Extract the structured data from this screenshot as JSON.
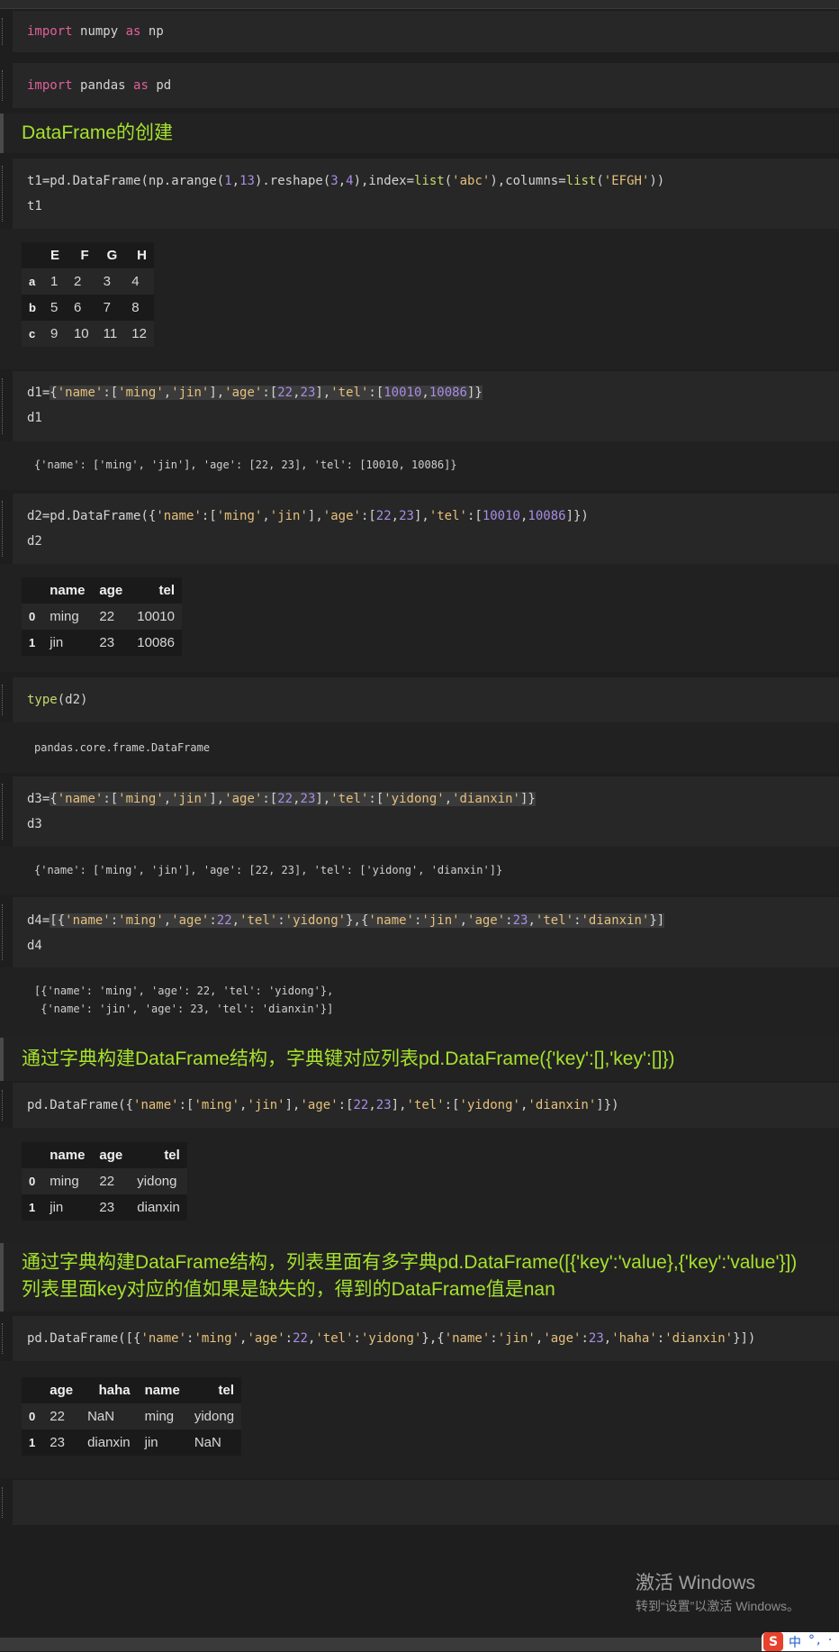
{
  "cells": {
    "c1": [
      "import numpy as np"
    ],
    "c2": [
      "import pandas as pd"
    ],
    "h1": "DataFrame的创建",
    "c3": [
      "t1=pd.DataFrame(np.arange(1,13).reshape(3,4),index=list('abc'),columns=list('EFGH'))",
      "t1"
    ],
    "t1": {
      "columns": [
        "",
        "E",
        "F",
        "G",
        "H"
      ],
      "rows": [
        [
          "a",
          "1",
          "2",
          "3",
          "4"
        ],
        [
          "b",
          "5",
          "6",
          "7",
          "8"
        ],
        [
          "c",
          "9",
          "10",
          "11",
          "12"
        ]
      ]
    },
    "c4": [
      "d1={'name':['ming','jin'],'age':[22,23],'tel':[10010,10086]}",
      "d1"
    ],
    "o4": [
      "{'name': ['ming', 'jin'], 'age': [22, 23], 'tel': [10010, 10086]}"
    ],
    "c5": [
      "d2=pd.DataFrame({'name':['ming','jin'],'age':[22,23],'tel':[10010,10086]})",
      "d2"
    ],
    "t2": {
      "columns": [
        "",
        "name",
        "age",
        "tel"
      ],
      "rows": [
        [
          "0",
          "ming",
          "22",
          "10010"
        ],
        [
          "1",
          "jin",
          "23",
          "10086"
        ]
      ]
    },
    "c6": [
      "type(d2)"
    ],
    "o6": [
      "pandas.core.frame.DataFrame"
    ],
    "c7": [
      "d3={'name':['ming','jin'],'age':[22,23],'tel':['yidong','dianxin']}",
      "d3"
    ],
    "o7": [
      "{'name': ['ming', 'jin'], 'age': [22, 23], 'tel': ['yidong', 'dianxin']}"
    ],
    "c8": [
      "d4=[{'name':'ming','age':22,'tel':'yidong'},{'name':'jin','age':23,'tel':'dianxin'}]",
      "d4"
    ],
    "o8": [
      "[{'name': 'ming', 'age': 22, 'tel': 'yidong'},",
      " {'name': 'jin', 'age': 23, 'tel': 'dianxin'}]"
    ],
    "h2": "通过字典构建DataFrame结构，字典键对应列表pd.DataFrame({'key':[],'key':[]})",
    "c9": [
      "pd.DataFrame({'name':['ming','jin'],'age':[22,23],'tel':['yidong','dianxin']})"
    ],
    "t3": {
      "columns": [
        "",
        "name",
        "age",
        "tel"
      ],
      "rows": [
        [
          "0",
          "ming",
          "22",
          "yidong"
        ],
        [
          "1",
          "jin",
          "23",
          "dianxin"
        ]
      ]
    },
    "h3": [
      "通过字典构建DataFrame结构，列表里面有多字典pd.DataFrame([{'key':'value},{'key':'value'}])",
      "列表里面key对应的值如果是缺失的，得到的DataFrame值是nan"
    ],
    "c10": [
      "pd.DataFrame([{'name':'ming','age':22,'tel':'yidong'},{'name':'jin','age':23,'haha':'dianxin'}])"
    ],
    "t4": {
      "columns": [
        "",
        "age",
        "haha",
        "name",
        "tel"
      ],
      "rows": [
        [
          "0",
          "22",
          "NaN",
          "ming",
          "yidong"
        ],
        [
          "1",
          "23",
          "dianxin",
          "jin",
          "NaN"
        ]
      ]
    }
  },
  "watermark": {
    "title": "激活 Windows",
    "subtitle": "转到“设置”以激活 Windows。"
  },
  "ime": {
    "logo": "S",
    "mode": "中",
    "dots": "°, ·"
  },
  "colors": {
    "keyword": "#e0609a",
    "function": "#c6d96b",
    "string": "#e6c07b",
    "number": "#a88de6",
    "heading": "#a6e22e"
  }
}
